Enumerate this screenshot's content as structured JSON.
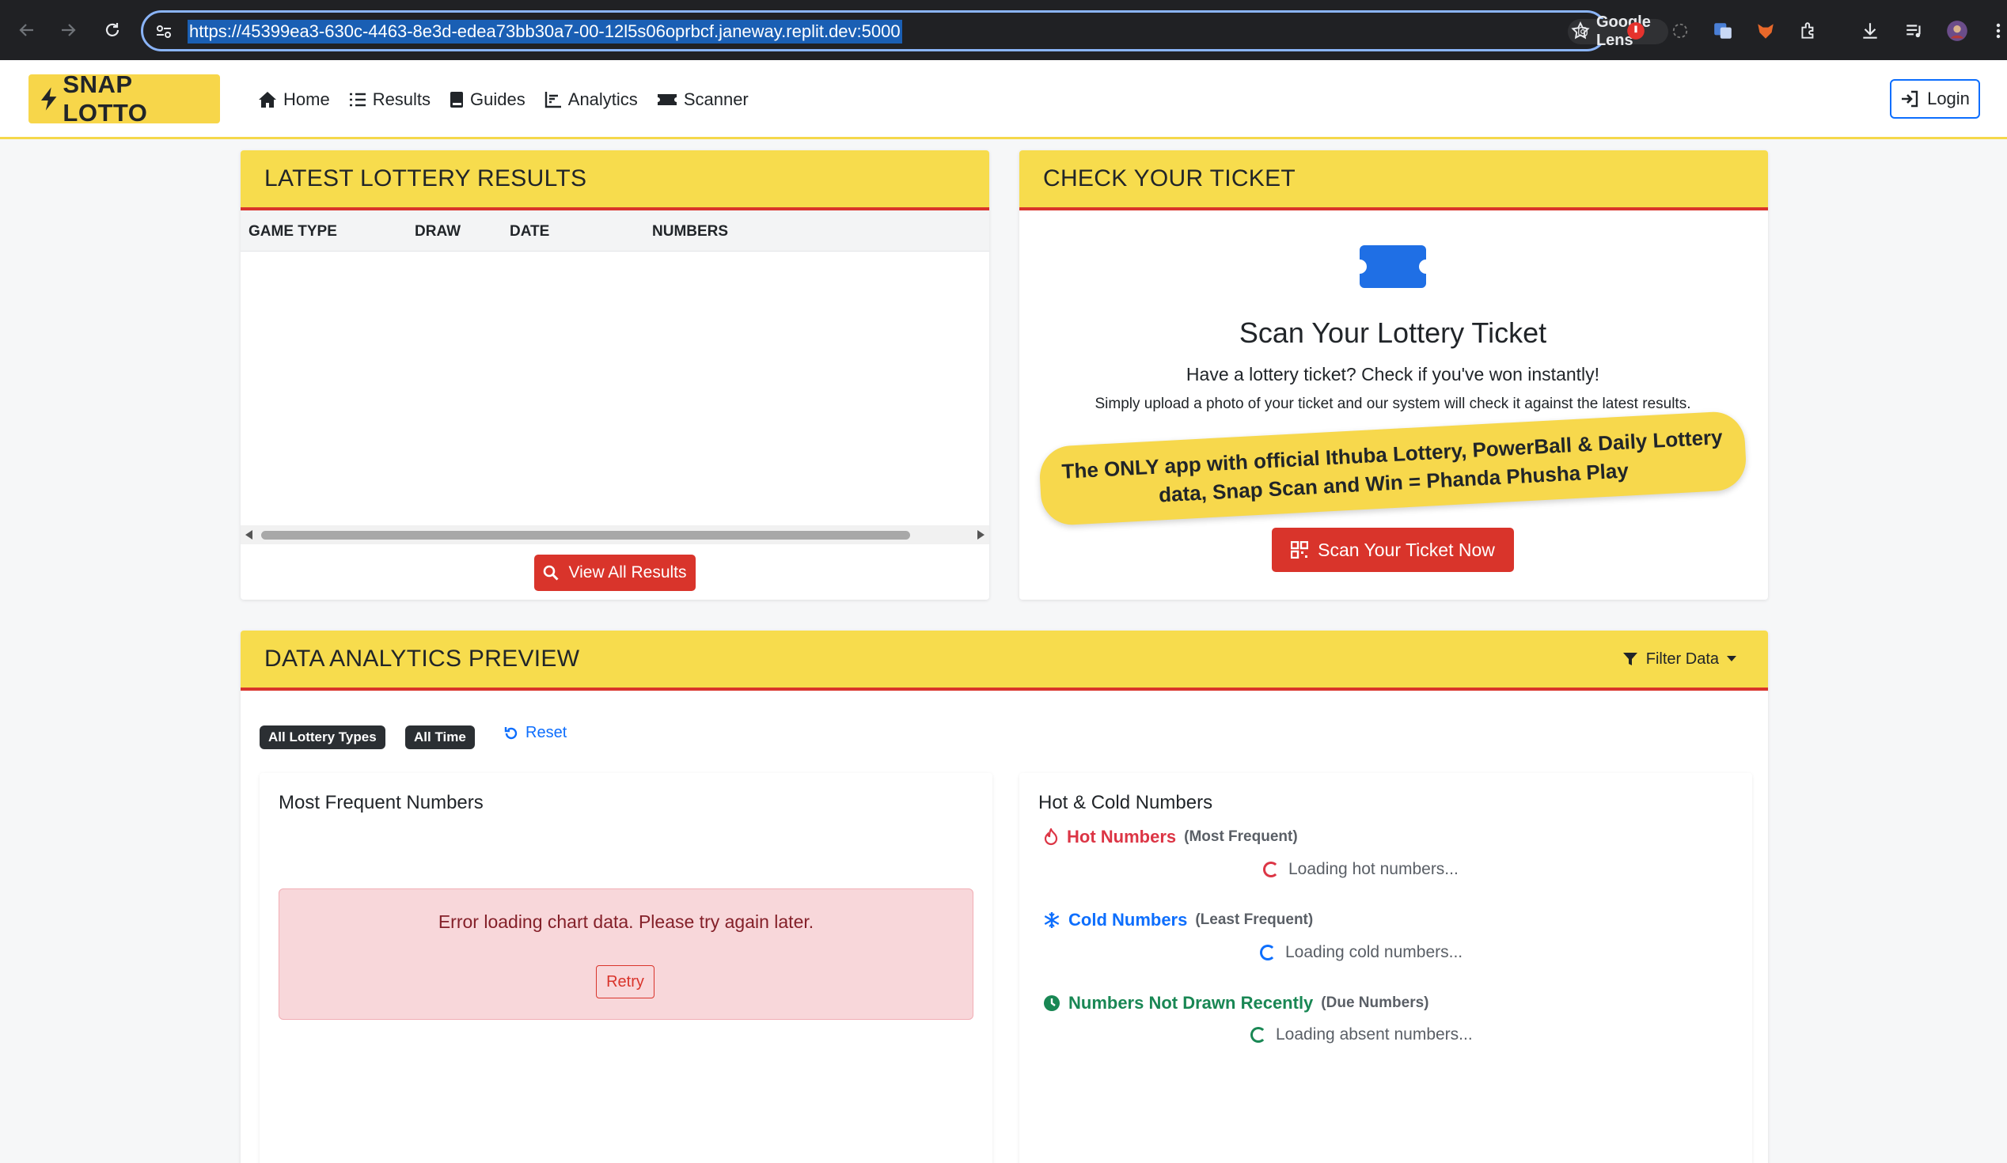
{
  "browser": {
    "url": "https://45399ea3-630c-4463-8e3d-edea73bb30a7-00-12l5s06oprbcf.janeway.replit.dev:5000",
    "lens_label": "Google Lens"
  },
  "nav": {
    "brand": "SNAP LOTTO",
    "links": [
      {
        "label": "Home",
        "icon": "home-icon"
      },
      {
        "label": "Results",
        "icon": "list-icon"
      },
      {
        "label": "Guides",
        "icon": "book-icon"
      },
      {
        "label": "Analytics",
        "icon": "chart-icon"
      },
      {
        "label": "Scanner",
        "icon": "ticket-icon"
      }
    ],
    "login": "Login"
  },
  "latest_results": {
    "title": "LATEST LOTTERY RESULTS",
    "columns": [
      "GAME TYPE",
      "DRAW",
      "DATE",
      "NUMBERS"
    ],
    "view_all": "View All Results"
  },
  "check_ticket": {
    "title": "CHECK YOUR TICKET",
    "scan_title": "Scan Your Lottery Ticket",
    "subtitle": "Have a lottery ticket? Check if you've won instantly!",
    "description": "Simply upload a photo of your ticket and our system will check it against the latest results.",
    "promo": "The ONLY app with official Ithuba Lottery, PowerBall & Daily Lottery data, Snap Scan and Win = Phanda Phusha Play",
    "scan_button": "Scan Your Ticket Now"
  },
  "analytics": {
    "title": "DATA ANALYTICS PREVIEW",
    "filter": "Filter Data",
    "badges": [
      "All Lottery Types",
      "All Time"
    ],
    "reset": "Reset",
    "frequent": {
      "title": "Most Frequent Numbers",
      "error": "Error loading chart data. Please try again later.",
      "retry": "Retry"
    },
    "hot_cold": {
      "title": "Hot & Cold Numbers",
      "hot": {
        "label": "Hot Numbers",
        "sub": "(Most Frequent)",
        "loading": "Loading hot numbers...",
        "color": "#dc3545"
      },
      "cold": {
        "label": "Cold Numbers",
        "sub": "(Least Frequent)",
        "loading": "Loading cold numbers...",
        "color": "#0d6efd"
      },
      "absent": {
        "label": "Numbers Not Drawn Recently",
        "sub": "(Due Numbers)",
        "loading": "Loading absent numbers...",
        "color": "#198754"
      }
    }
  }
}
